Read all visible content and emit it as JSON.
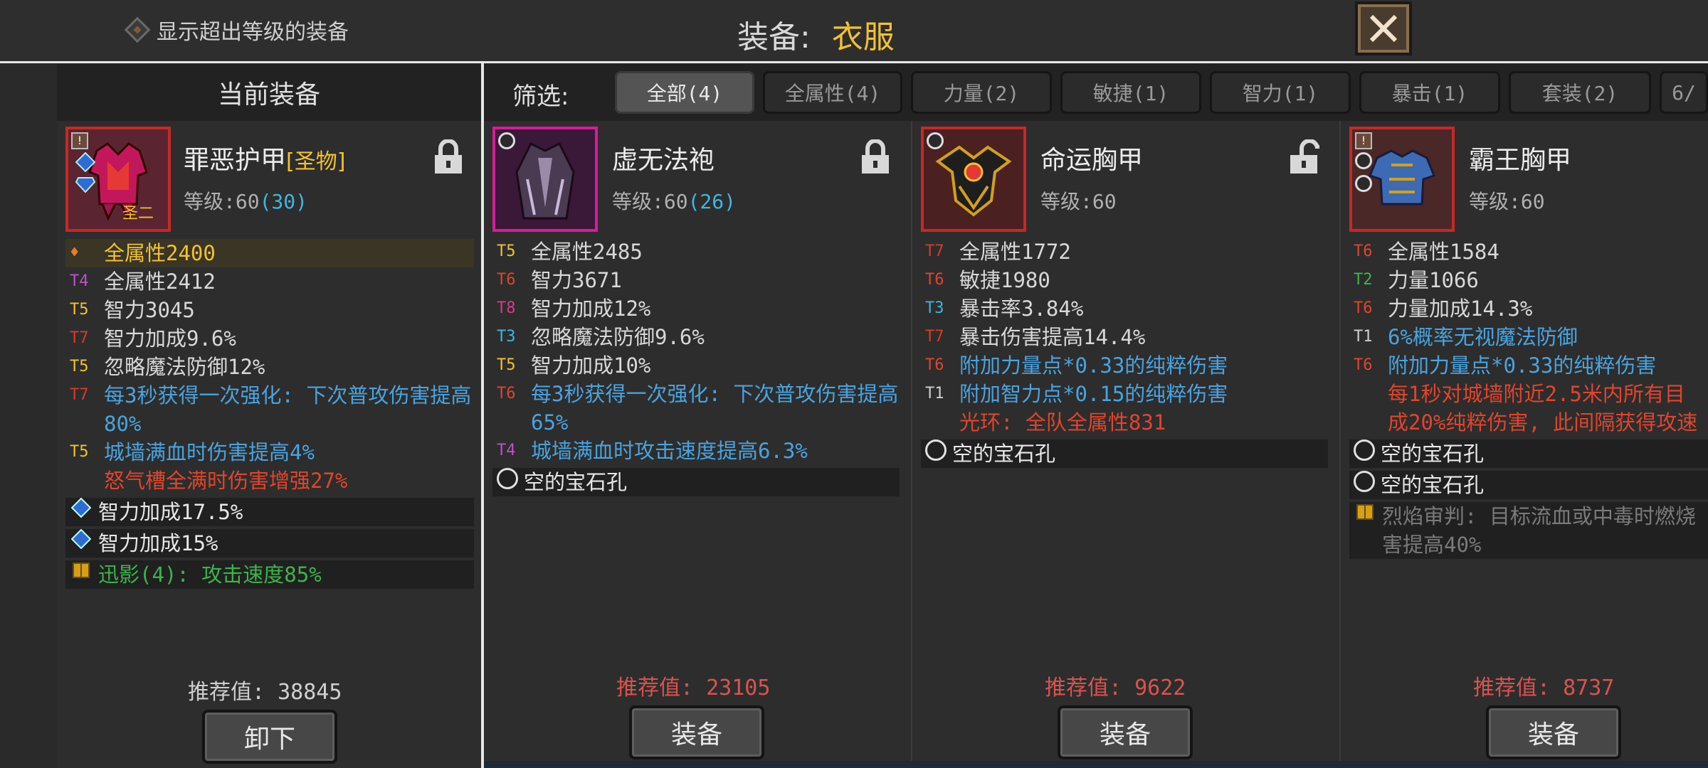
{
  "top": {
    "show_over_label": "显示超出等级的装备",
    "slot_label": "装备:",
    "slot_value": "衣服"
  },
  "current": {
    "header": "当前装备",
    "name": "罪恶护甲",
    "tag": "[圣物]",
    "badge": "圣二",
    "level_prefix": "等级:60",
    "level_bonus": "(30)",
    "stats": [
      {
        "tier": "",
        "text": "全属性2400",
        "color": "#f1c232"
      },
      {
        "tier": "T4",
        "text": "全属性2412",
        "color": "#d8d8d8",
        "tier_color": "#c050c8"
      },
      {
        "tier": "T5",
        "text": "智力3045",
        "color": "#d8d8d8",
        "tier_color": "#f1c232"
      },
      {
        "tier": "T7",
        "text": "智力加成9.6%",
        "color": "#d8d8d8",
        "tier_color": "#d83a2a"
      },
      {
        "tier": "T5",
        "text": "忽略魔法防御12%",
        "color": "#d8d8d8",
        "tier_color": "#f1c232"
      },
      {
        "tier": "T7",
        "text": "每3秒获得一次强化: 下次普攻伤害提高80%",
        "color": "#4aa3df",
        "tier_color": "#d83a2a"
      },
      {
        "tier": "T5",
        "text": "城墙满血时伤害提高4%",
        "color": "#4aa3df",
        "tier_color": "#f1c232"
      },
      {
        "tier": "",
        "text": "怒气槽全满时伤害增强27%",
        "color": "#e0452d"
      }
    ],
    "gems": [
      "智力加成17.5%",
      "智力加成15%"
    ],
    "set_text": "迅影(4): 攻击速度85%",
    "rec_label": "推荐值:",
    "rec_value": "38845",
    "button": "卸下"
  },
  "filter": {
    "label": "筛选:",
    "chips": [
      "全部(4)",
      "全属性(4)",
      "力量(2)",
      "敏捷(1)",
      "智力(1)",
      "暴击(1)",
      "套装(2)",
      "6/"
    ]
  },
  "items": [
    {
      "name": "虚无法袍",
      "level_prefix": "等级:60",
      "level_bonus": "(26)",
      "stats": [
        {
          "tier": "T5",
          "text": "全属性2485",
          "color": "#d8d8d8",
          "tier_color": "#f1c232"
        },
        {
          "tier": "T6",
          "text": "智力3671",
          "color": "#d8d8d8",
          "tier_color": "#e0452d"
        },
        {
          "tier": "T8",
          "text": "智力加成12%",
          "color": "#d8d8d8",
          "tier_color": "#d83a8a"
        },
        {
          "tier": "T3",
          "text": "忽略魔法防御9.6%",
          "color": "#d8d8d8",
          "tier_color": "#3fb6e0"
        },
        {
          "tier": "T5",
          "text": "智力加成10%",
          "color": "#d8d8d8",
          "tier_color": "#f1c232"
        },
        {
          "tier": "T6",
          "text": "每3秒获得一次强化: 下次普攻伤害提高65%",
          "color": "#4aa3df",
          "tier_color": "#e0452d"
        },
        {
          "tier": "T4",
          "text": "城墙满血时攻击速度提高6.3%",
          "color": "#4aa3df",
          "tier_color": "#c050c8"
        }
      ],
      "sockets": [
        "空的宝石孔"
      ],
      "rec_label": "推荐值:",
      "rec_value": "23105",
      "button": "装备"
    },
    {
      "name": "命运胸甲",
      "level_prefix": "等级:60",
      "level_bonus": "",
      "stats": [
        {
          "tier": "T7",
          "text": "全属性1772",
          "color": "#d8d8d8",
          "tier_color": "#d83a2a"
        },
        {
          "tier": "T6",
          "text": "敏捷1980",
          "color": "#d8d8d8",
          "tier_color": "#e0452d"
        },
        {
          "tier": "T3",
          "text": "暴击率3.84%",
          "color": "#d8d8d8",
          "tier_color": "#3fb6e0"
        },
        {
          "tier": "T7",
          "text": "暴击伤害提高14.4%",
          "color": "#d8d8d8",
          "tier_color": "#d83a2a"
        },
        {
          "tier": "T6",
          "text": "附加力量点*0.33的纯粹伤害",
          "color": "#4aa3df",
          "tier_color": "#e0452d"
        },
        {
          "tier": "T1",
          "text": "附加智力点*0.15的纯粹伤害",
          "color": "#4aa3df",
          "tier_color": "#cfcfcf"
        },
        {
          "tier": "",
          "text": "光环: 全队全属性831",
          "color": "#e0452d"
        }
      ],
      "sockets": [
        "空的宝石孔"
      ],
      "rec_label": "推荐值:",
      "rec_value": "9622",
      "button": "装备"
    },
    {
      "name": "霸王胸甲",
      "level_prefix": "等级:60",
      "level_bonus": "",
      "stats": [
        {
          "tier": "T6",
          "text": "全属性1584",
          "color": "#d8d8d8",
          "tier_color": "#e0452d"
        },
        {
          "tier": "T2",
          "text": "力量1066",
          "color": "#d8d8d8",
          "tier_color": "#3cb44b"
        },
        {
          "tier": "T6",
          "text": "力量加成14.3%",
          "color": "#d8d8d8",
          "tier_color": "#e0452d"
        },
        {
          "tier": "T1",
          "text": "6%概率无视魔法防御",
          "color": "#4aa3df",
          "tier_color": "#cfcfcf"
        },
        {
          "tier": "T6",
          "text": "附加力量点*0.33的纯粹伤害",
          "color": "#4aa3df",
          "tier_color": "#e0452d"
        },
        {
          "tier": "",
          "text": "每1秒对城墙附近2.5米内所有目",
          "color": "#e0452d"
        },
        {
          "tier": "",
          "text": "成20%纯粹伤害, 此间隔获得攻速",
          "color": "#e0452d"
        }
      ],
      "sockets": [
        "空的宝石孔",
        "空的宝石孔"
      ],
      "set_text": "烈焰审判: 目标流血或中毒时燃烧",
      "set_text2": "害提高40%",
      "rec_label": "推荐值:",
      "rec_value": "8737",
      "button": "装备"
    }
  ],
  "colors": {
    "accent_gold": "#f1c232",
    "rec_red": "#d9534f",
    "stat_blue": "#4aa3df",
    "special_red": "#e0452d",
    "set_green": "#3cb44b"
  }
}
